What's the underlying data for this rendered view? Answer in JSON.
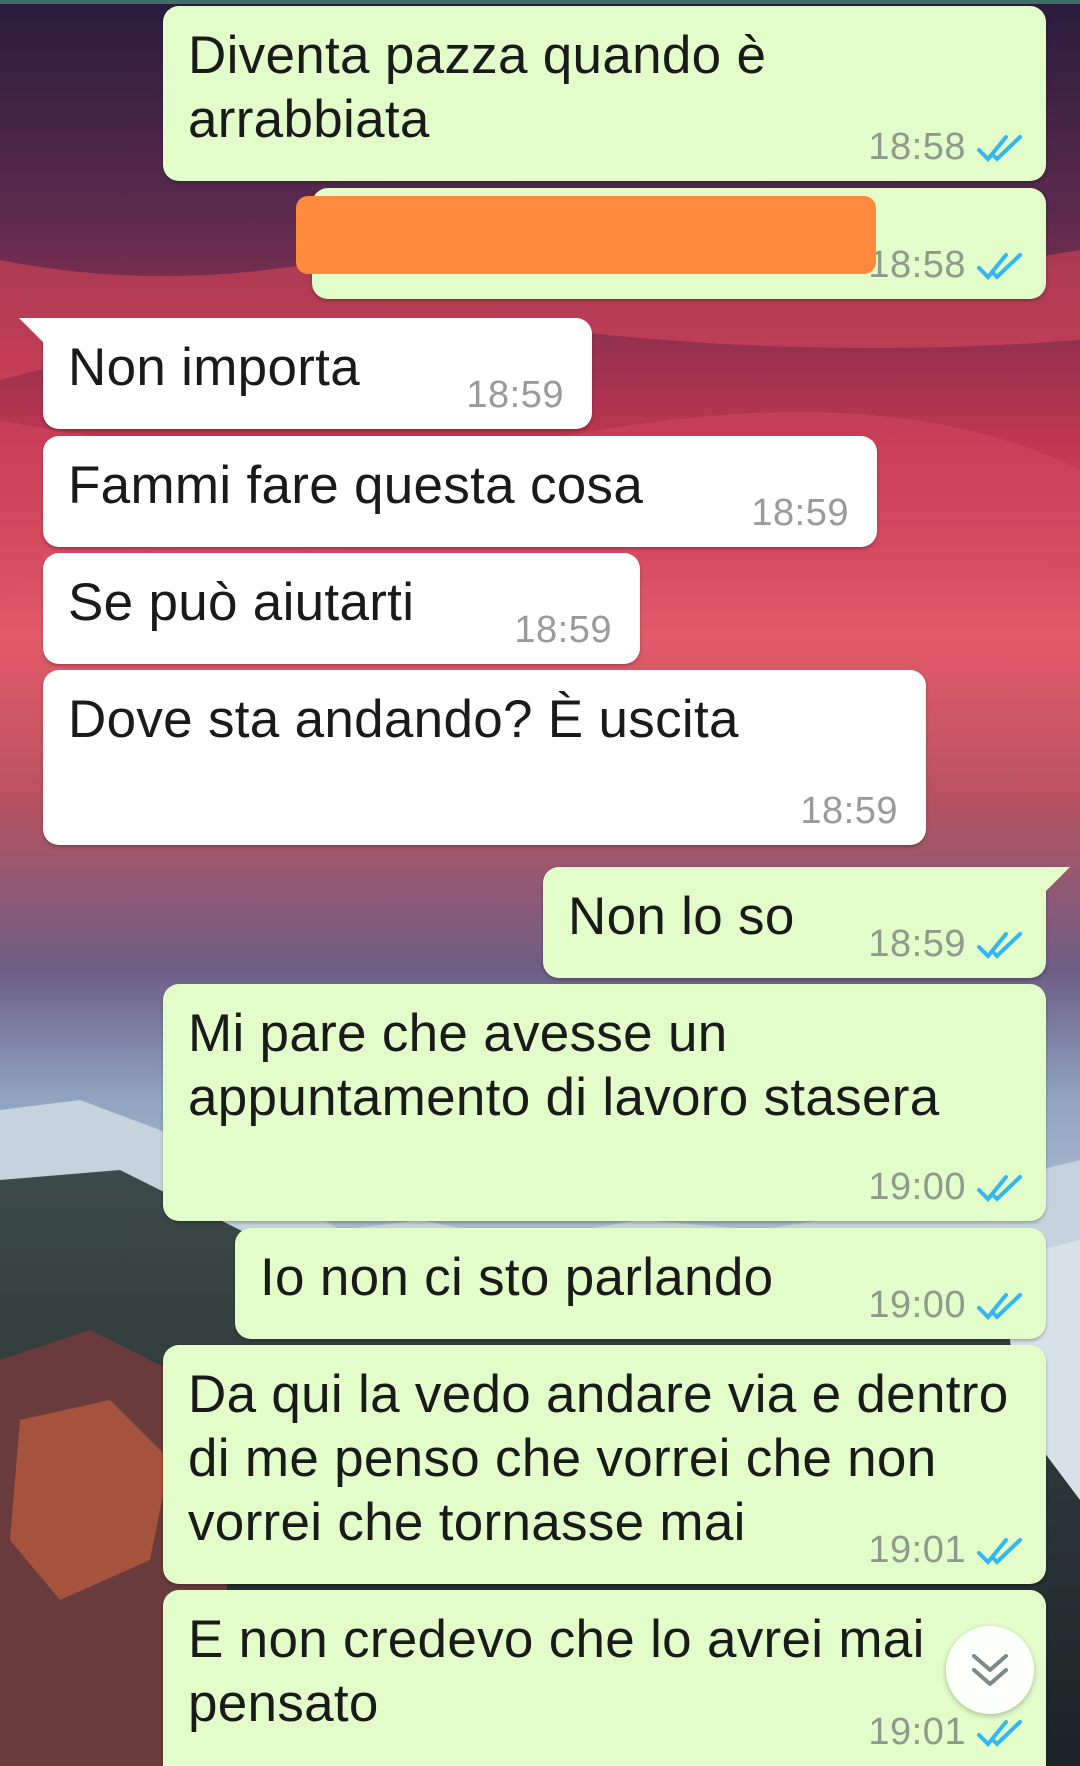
{
  "messages": [
    {
      "text": "Diventa pazza quando è\narrabbiata",
      "time": "18:58"
    },
    {
      "text": "",
      "time": "18:58"
    },
    {
      "text": "Non importa",
      "time": "18:59"
    },
    {
      "text": "Fammi fare questa cosa",
      "time": "18:59"
    },
    {
      "text": "Se può aiutarti",
      "time": "18:59"
    },
    {
      "text": "Dove sta andando? È uscita",
      "time": "18:59"
    },
    {
      "text": "Non lo so",
      "time": "18:59"
    },
    {
      "text": "Mi pare che avesse un\nappuntamento di lavoro stasera",
      "time": "19:00"
    },
    {
      "text": "Io non ci sto parlando",
      "time": "19:00"
    },
    {
      "text": "Da qui la vedo andare via e dentro\ndi me penso che vorrei che non\nvorrei che tornasse mai",
      "time": "19:01"
    },
    {
      "text": "E non credevo che lo avrei mai\npensato",
      "time": "19:01"
    }
  ],
  "colors": {
    "outgoing_bubble": "#e2fdc9",
    "incoming_bubble": "#ffffff",
    "read_tick": "#34b7f1",
    "redaction": "#ff8a3d"
  },
  "icons": {
    "read_receipt": "double-check-icon",
    "scroll_down": "chevron-double-down-icon"
  }
}
